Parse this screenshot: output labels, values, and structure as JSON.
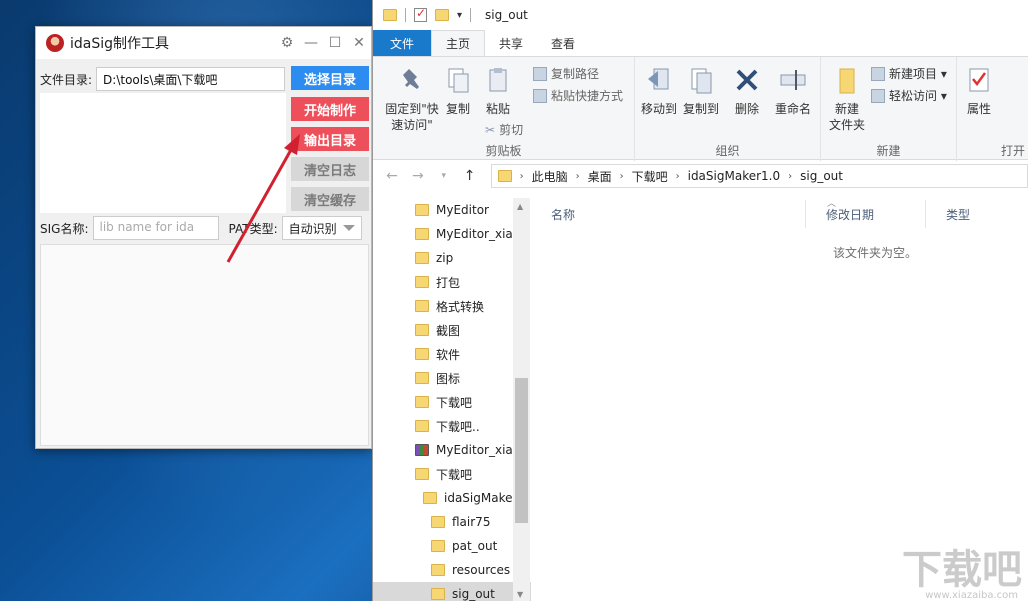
{
  "ida": {
    "title": "idaSig制作工具",
    "dir_label": "文件目录:",
    "dir_value": "D:\\tools\\桌面\\下载吧",
    "btn_select": "选择目录",
    "btn_start": "开始制作",
    "btn_output": "输出目录",
    "btn_clear_log": "清空日志",
    "btn_clear_cache": "清空缓存",
    "sig_label": "SIG名称:",
    "sig_placeholder": "lib name for ida",
    "pat_label": "PAT类型:",
    "pat_value": "自动识别"
  },
  "explorer": {
    "title": "sig_out",
    "tabs": [
      "文件",
      "主页",
      "共享",
      "查看"
    ],
    "ribbon": {
      "pin": "固定到\"快",
      "pin2": "速访问\"",
      "copy": "复制",
      "paste": "粘贴",
      "copy_path": "复制路径",
      "paste_shortcut": "粘贴快捷方式",
      "cut": "剪切",
      "clipboard_group": "剪贴板",
      "move_to": "移动到",
      "copy_to": "复制到",
      "delete": "删除",
      "rename": "重命名",
      "organize_group": "组织",
      "new_folder": "新建",
      "new_folder2": "文件夹",
      "new_item": "新建项目 ▾",
      "easy_access": "轻松访问 ▾",
      "new_group": "新建",
      "properties": "属性",
      "open_group": "打开"
    },
    "breadcrumb": [
      "此电脑",
      "桌面",
      "下载吧",
      "idaSigMaker1.0",
      "sig_out"
    ],
    "columns": [
      "名称",
      "修改日期",
      "类型"
    ],
    "empty_text": "该文件夹为空。",
    "tree": [
      {
        "label": "MyEditor",
        "indent": 0
      },
      {
        "label": "MyEditor_xiaz",
        "indent": 0
      },
      {
        "label": "zip",
        "indent": 0
      },
      {
        "label": "打包",
        "indent": 0
      },
      {
        "label": "格式转换",
        "indent": 0
      },
      {
        "label": "截图",
        "indent": 0
      },
      {
        "label": "软件",
        "indent": 0
      },
      {
        "label": "图标",
        "indent": 0
      },
      {
        "label": "下载吧",
        "indent": 0
      },
      {
        "label": "下载吧..",
        "indent": 0
      },
      {
        "label": "MyEditor_xiaz",
        "indent": 0,
        "archive": true
      },
      {
        "label": "下载吧",
        "indent": 0
      },
      {
        "label": "idaSigMake",
        "indent": 1
      },
      {
        "label": "flair75",
        "indent": 2
      },
      {
        "label": "pat_out",
        "indent": 2
      },
      {
        "label": "resources",
        "indent": 2
      },
      {
        "label": "sig_out",
        "indent": 2,
        "selected": true
      }
    ]
  },
  "watermark": "下载吧",
  "watermark_url": "www.xiazaiba.com"
}
